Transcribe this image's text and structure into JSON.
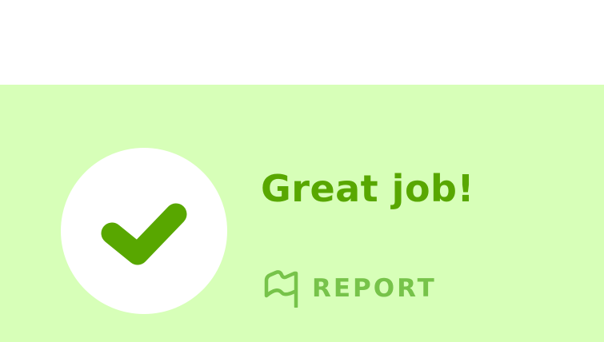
{
  "colors": {
    "panel_background": "#d7ffb8",
    "headline_text": "#58a700",
    "check_mark": "#58a700",
    "report_text": "#77c34a"
  },
  "feedback": {
    "status_icon": "checkmark-icon",
    "headline": "Great job!",
    "report_icon": "flag-icon",
    "report_label": "REPORT"
  }
}
